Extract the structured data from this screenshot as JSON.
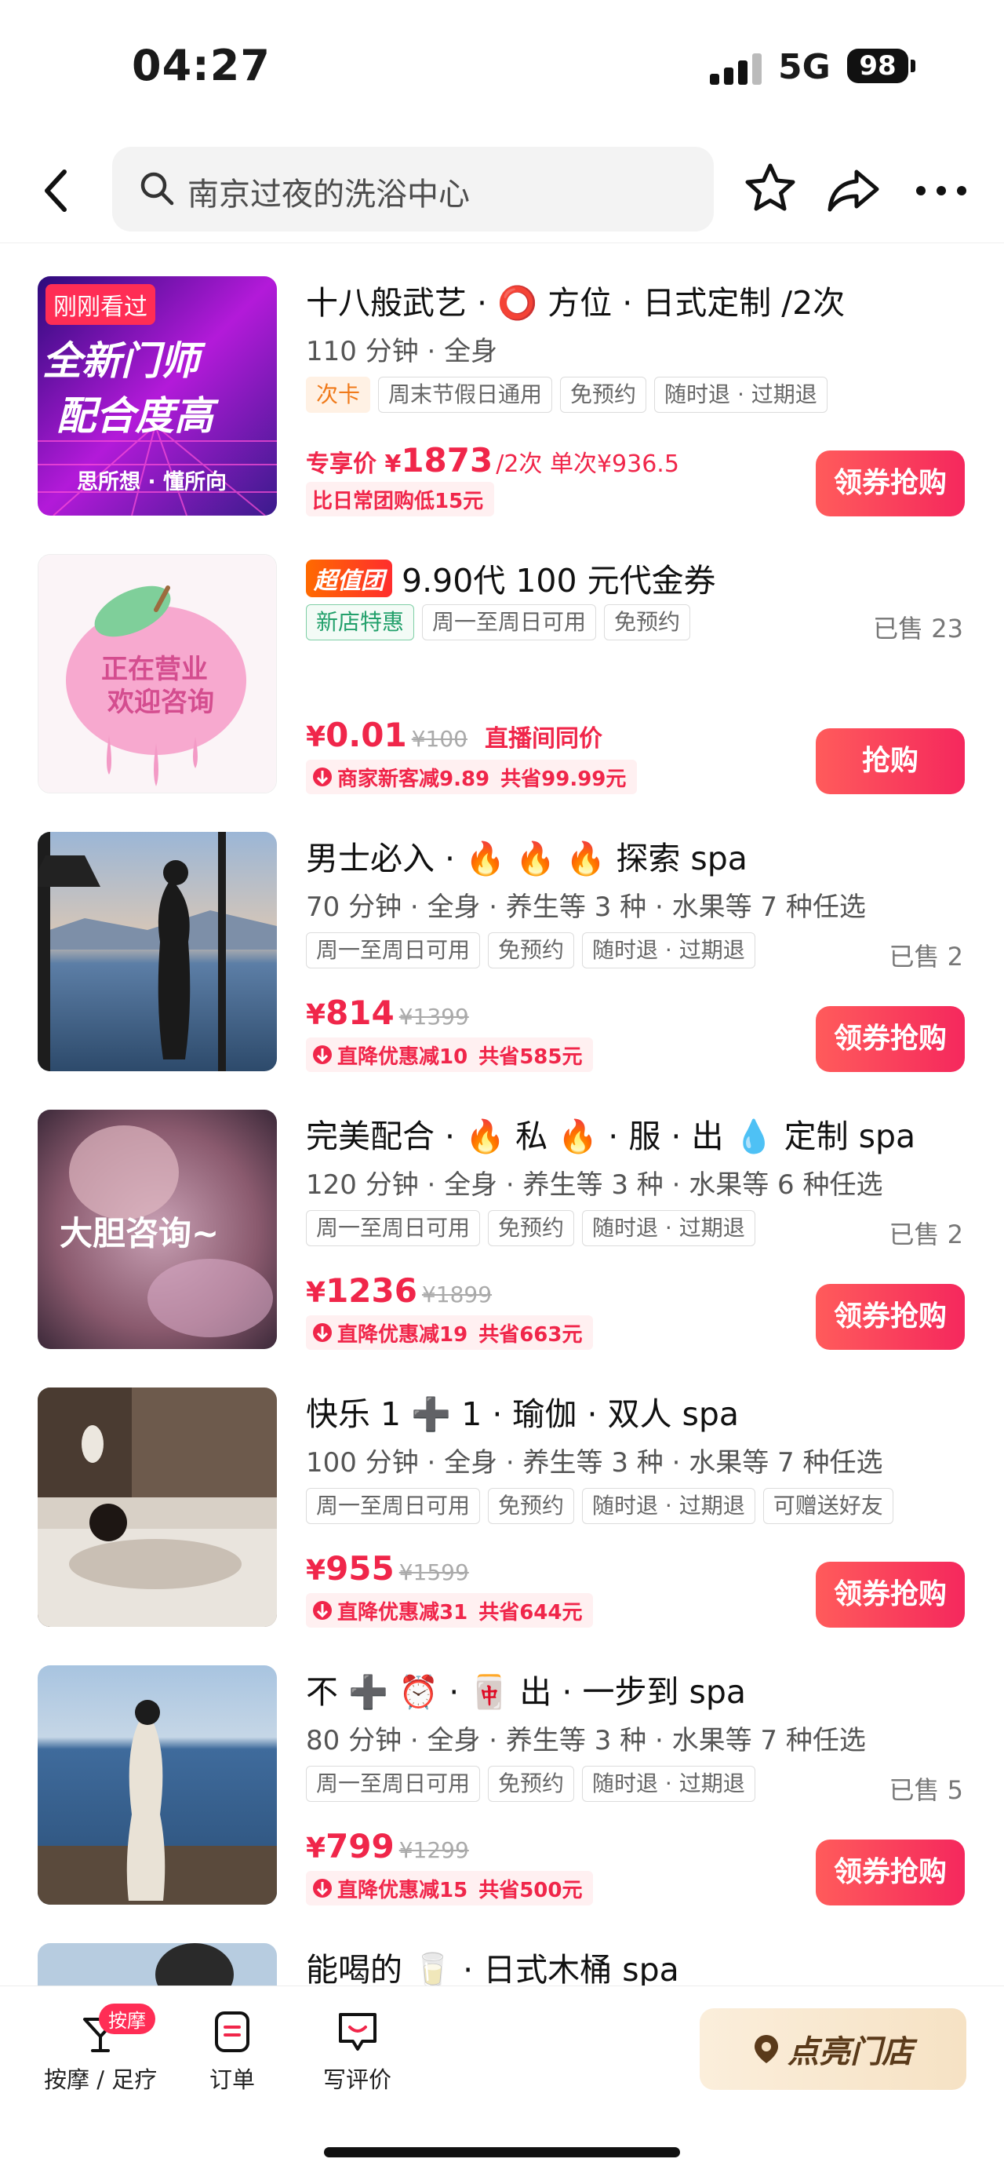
{
  "status": {
    "time": "04:27",
    "network": "5G",
    "battery": "98"
  },
  "search": {
    "query": "南京过夜的洗浴中心"
  },
  "products": [
    {
      "title": "十八般武艺 · ⭕ 方位 · 日式定制 /2次",
      "subtitle": "110 分钟 · 全身",
      "tags": [
        "次卡",
        "周末节假日通用",
        "免预约",
        "随时退 · 过期退"
      ],
      "thumb_badge": "刚刚看过",
      "thumb_text_1": "全新门师",
      "thumb_text_2": "配合度高",
      "thumb_text_3": "思所想 · 懂所向",
      "price_prefix": "专享价 ¥",
      "price": "1873",
      "price_suffix": "/2次 单次¥936.5",
      "price_note": "比日常团购低15元",
      "button": "领券抢购"
    },
    {
      "badge": "超值团",
      "title": "9.90代 100 元代金券",
      "tags": [
        "新店特惠",
        "周一至周日可用",
        "免预约"
      ],
      "sold": "已售 23",
      "thumb_text_1": "正在营业",
      "thumb_text_2": "欢迎咨询",
      "price": "0.01",
      "orig": "¥100",
      "price_note": "直播间同价",
      "discount_label": "商家新客减9.89",
      "discount_save": "共省99.99元",
      "button": "抢购"
    },
    {
      "title": "男士必入 · 🔥 🔥 🔥 探索 spa",
      "subtitle": "70 分钟 · 全身 · 养生等 3 种 · 水果等 7 种任选",
      "tags": [
        "周一至周日可用",
        "免预约",
        "随时退 · 过期退"
      ],
      "sold": "已售 2",
      "price": "814",
      "orig": "¥1399",
      "discount_label": "直降优惠减10",
      "discount_save": "共省585元",
      "button": "领券抢购"
    },
    {
      "title": "完美配合 · 🔥 私 🔥 · 服 · 出 💧 定制 spa",
      "subtitle": "120 分钟 · 全身 · 养生等 3 种 · 水果等 6 种任选",
      "tags": [
        "周一至周日可用",
        "免预约",
        "随时退 · 过期退"
      ],
      "sold": "已售 2",
      "thumb_text_1": "大胆咨询~",
      "price": "1236",
      "orig": "¥1899",
      "discount_label": "直降优惠减19",
      "discount_save": "共省663元",
      "button": "领券抢购"
    },
    {
      "title": "快乐 1 ➕ 1 · 瑜伽 · 双人 spa",
      "subtitle": "100 分钟 · 全身 · 养生等 3 种 · 水果等 7 种任选",
      "tags": [
        "周一至周日可用",
        "免预约",
        "随时退 · 过期退",
        "可赠送好友"
      ],
      "price": "955",
      "orig": "¥1599",
      "discount_label": "直降优惠减31",
      "discount_save": "共省644元",
      "button": "领券抢购"
    },
    {
      "title": "不 ➕ ⏰ · 🀄 出 · 一步到 spa",
      "subtitle": "80 分钟 · 全身 · 养生等 3 种 · 水果等 7 种任选",
      "tags": [
        "周一至周日可用",
        "免预约",
        "随时退 · 过期退"
      ],
      "sold": "已售 5",
      "price": "799",
      "orig": "¥1299",
      "discount_label": "直降优惠减15",
      "discount_save": "共省500元",
      "button": "领券抢购"
    },
    {
      "title": "能喝的 🥛 · 日式木桶 spa"
    }
  ],
  "tabbar": {
    "massage_label": "按摩 / 足疗",
    "massage_badge": "按摩",
    "orders_label": "订单",
    "review_label": "写评价",
    "cta_label": "点亮门店"
  },
  "colors": {
    "accent": "#f0264a",
    "cta_bg": "#f6e2c4"
  }
}
